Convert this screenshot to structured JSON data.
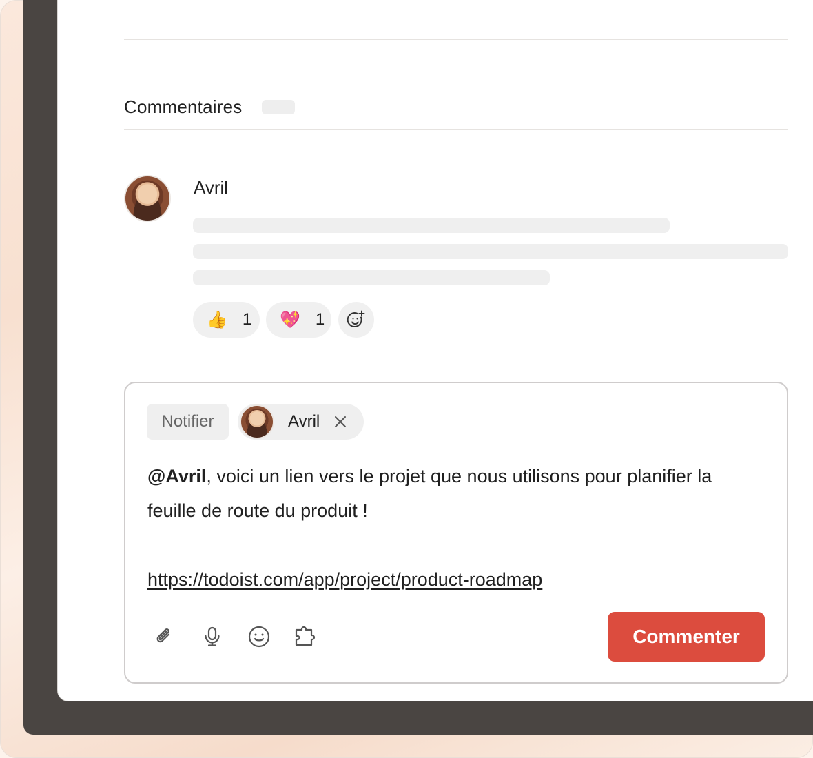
{
  "comments_section": {
    "title": "Commentaires"
  },
  "comment": {
    "author": "Avril",
    "reactions": [
      {
        "emoji": "👍",
        "count": "1"
      },
      {
        "emoji": "💖",
        "count": "1"
      }
    ]
  },
  "composer": {
    "notify_label": "Notifier",
    "notify_person": "Avril",
    "mention": "@Avril",
    "message": ", voici un lien vers le projet que nous utilisons pour planifier la feuille de route du produit !",
    "link": "https://todoist.com/app/project/product-roadmap",
    "submit_label": "Commenter",
    "tools": [
      "paperclip-icon",
      "microphone-icon",
      "emoji-icon",
      "extension-icon"
    ]
  },
  "colors": {
    "accent": "#dc4c3e",
    "frame_dark": "#4a4542",
    "skeleton": "#efefef"
  }
}
